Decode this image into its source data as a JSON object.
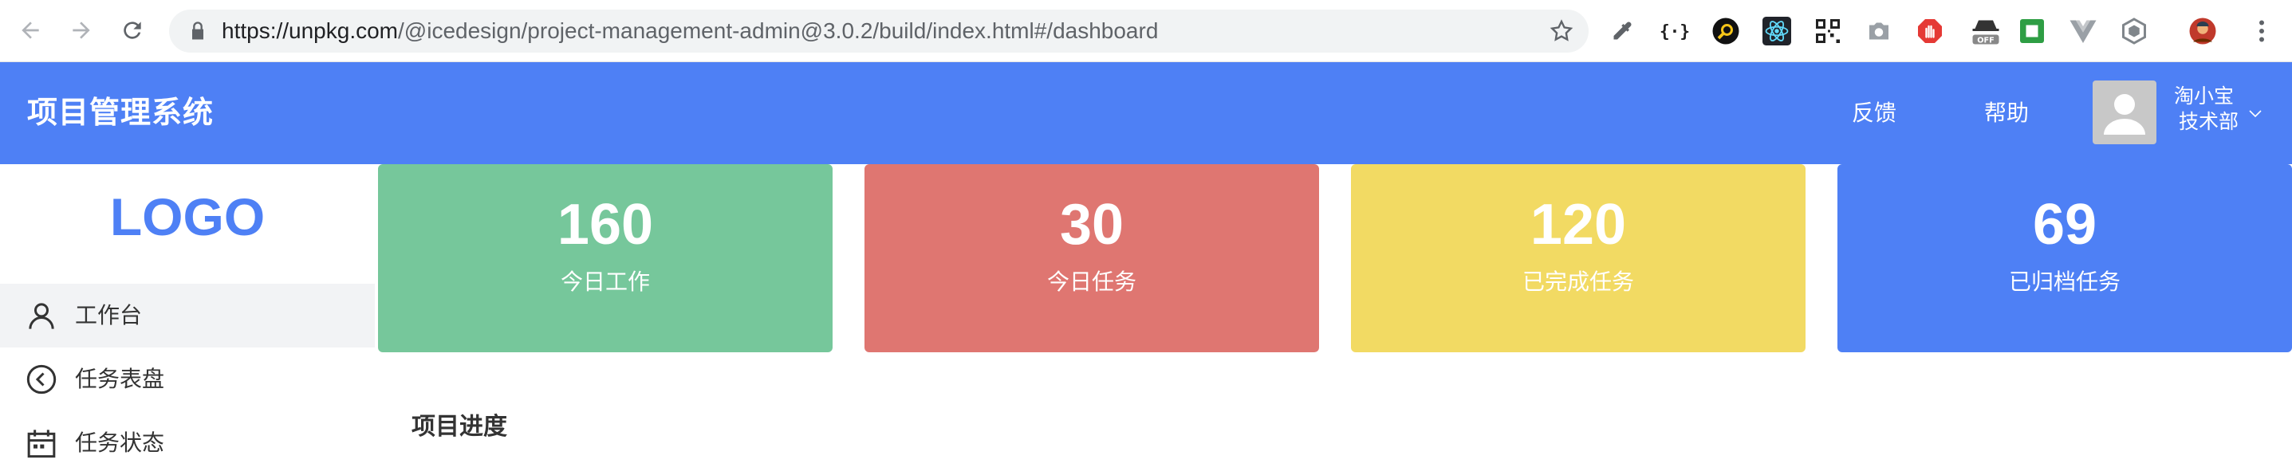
{
  "browser": {
    "url_host": "https://unpkg.com",
    "url_path": "/@icedesign/project-management-admin@3.0.2/build/index.html#/dashboard",
    "extensions": [
      "eyedropper-icon",
      "json-braces-icon",
      "search-circle-icon",
      "react-icon",
      "qr-code-icon",
      "camera-icon",
      "stop-hand-icon",
      "incognito-off-icon",
      "square-green-icon",
      "vue-icon",
      "hexagon-icon",
      "profile-avatar-icon",
      "more-vert-icon"
    ],
    "ext_off_badge": "OFF"
  },
  "header": {
    "title": "项目管理系统",
    "feedback_label": "反馈",
    "help_label": "帮助",
    "user_name": "淘小宝",
    "user_dept": "技术部"
  },
  "sidebar": {
    "logo": "LOGO",
    "items": [
      {
        "label": "工作台",
        "icon": "user-icon",
        "active": true
      },
      {
        "label": "任务表盘",
        "icon": "back-circle-icon",
        "active": false
      },
      {
        "label": "任务状态",
        "icon": "calendar-icon",
        "active": false
      }
    ]
  },
  "stats": [
    {
      "value": "160",
      "label": "今日工作",
      "color": "#76c79b"
    },
    {
      "value": "30",
      "label": "今日任务",
      "color": "#df7671"
    },
    {
      "value": "120",
      "label": "已完成任务",
      "color": "#f2da63"
    },
    {
      "value": "69",
      "label": "已归档任务",
      "color": "#4e80f5"
    }
  ],
  "section": {
    "title": "项目进度"
  },
  "colors": {
    "primary": "#4e80f5",
    "sidebar_active": "#f2f3f5"
  }
}
